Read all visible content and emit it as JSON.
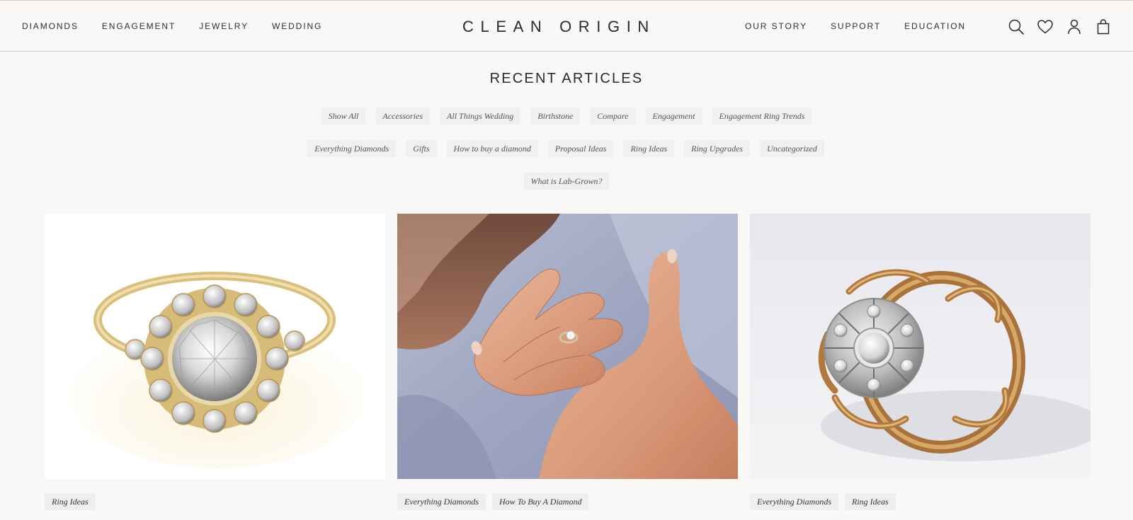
{
  "header": {
    "nav_left": [
      "DIAMONDS",
      "ENGAGEMENT",
      "JEWELRY",
      "WEDDING"
    ],
    "logo": "CLEAN ORIGIN",
    "nav_right": [
      "OUR STORY",
      "SUPPORT",
      "EDUCATION"
    ],
    "icons": [
      "search-icon",
      "heart-icon",
      "user-icon",
      "bag-icon"
    ]
  },
  "section_title": "RECENT ARTICLES",
  "filters": {
    "row1": [
      "Show All",
      "Accessories",
      "All Things Wedding",
      "Birthstone",
      "Compare",
      "Engagement",
      "Engagement Ring Trends"
    ],
    "row2": [
      "Everything Diamonds",
      "Gifts",
      "How to buy a diamond",
      "Proposal Ideas",
      "Ring Ideas",
      "Ring Upgrades",
      "Uncategorized"
    ],
    "row3": [
      "What is Lab-Grown?"
    ]
  },
  "articles": [
    {
      "image": "gold-halo-diamond-ring",
      "tags": [
        "Ring Ideas"
      ]
    },
    {
      "image": "hands-with-engagement-ring",
      "tags": [
        "Everything Diamonds",
        "How To Buy A Diamond"
      ]
    },
    {
      "image": "vintage-filigree-ring",
      "tags": [
        "Everything Diamonds",
        "Ring Ideas"
      ]
    }
  ],
  "colors": {
    "background": "#f9f8f6",
    "tag_background": "#eef0f2",
    "header_top_border": "#e4c9b8",
    "text": "#2b2b2b"
  }
}
